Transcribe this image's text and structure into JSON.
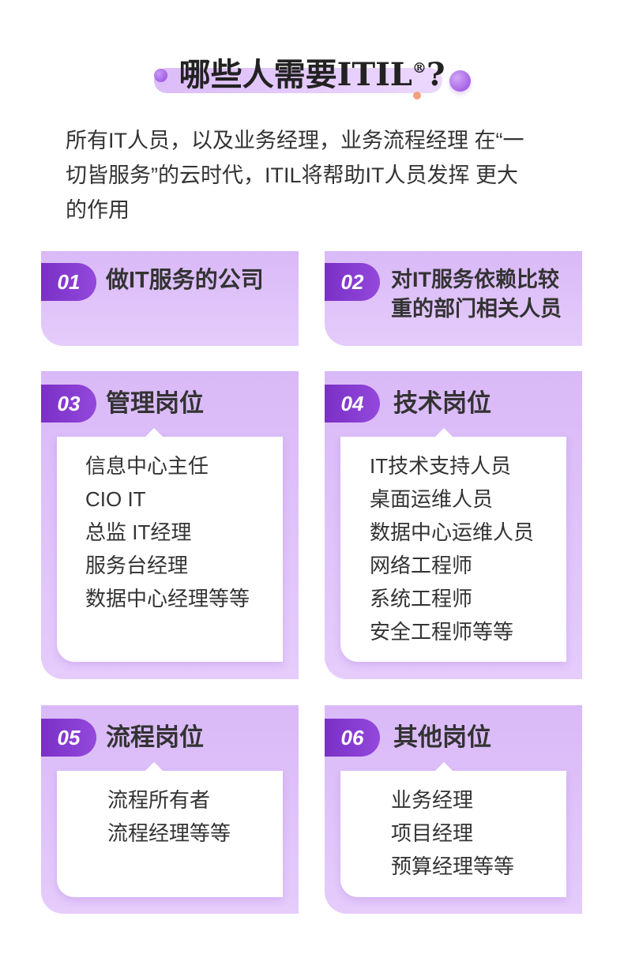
{
  "header": {
    "title": "哪些人需要ITIL",
    "title_reg": "®",
    "title_q": "?"
  },
  "intro": {
    "lines": [
      "所有IT人员，以及业务经理，业务流程经理 在“一",
      "切皆服务”的云时代，ITIL将帮助IT人员发挥 更大",
      "的作用"
    ]
  },
  "cards": [
    {
      "num": "01",
      "title_lines": [
        "做IT服务的公司"
      ]
    },
    {
      "num": "02",
      "title_lines": [
        "对IT服务依赖比较",
        "重的部门相关人员"
      ]
    },
    {
      "num": "03",
      "title": "管理岗位",
      "items": [
        "信息中心主任",
        "CIO IT",
        "总监 IT经理",
        "服务台经理",
        "数据中心经理等等"
      ]
    },
    {
      "num": "04",
      "title": "技术岗位",
      "items": [
        "IT技术支持人员",
        "桌面运维人员",
        "数据中心运维人员",
        "网络工程师",
        "系统工程师",
        "安全工程师等等"
      ]
    },
    {
      "num": "05",
      "title": "流程岗位",
      "items": [
        "流程所有者",
        "流程经理等等"
      ]
    },
    {
      "num": "06",
      "title": "其他岗位",
      "items": [
        "业务经理",
        "项目经理",
        "预算经理等等"
      ]
    }
  ],
  "colors": {
    "accent": "#9448dc",
    "card_bg": "#e5ccfb",
    "title_bar": "#ecd8fd",
    "orange_dot": "#f4a07f",
    "text": "#333333"
  }
}
